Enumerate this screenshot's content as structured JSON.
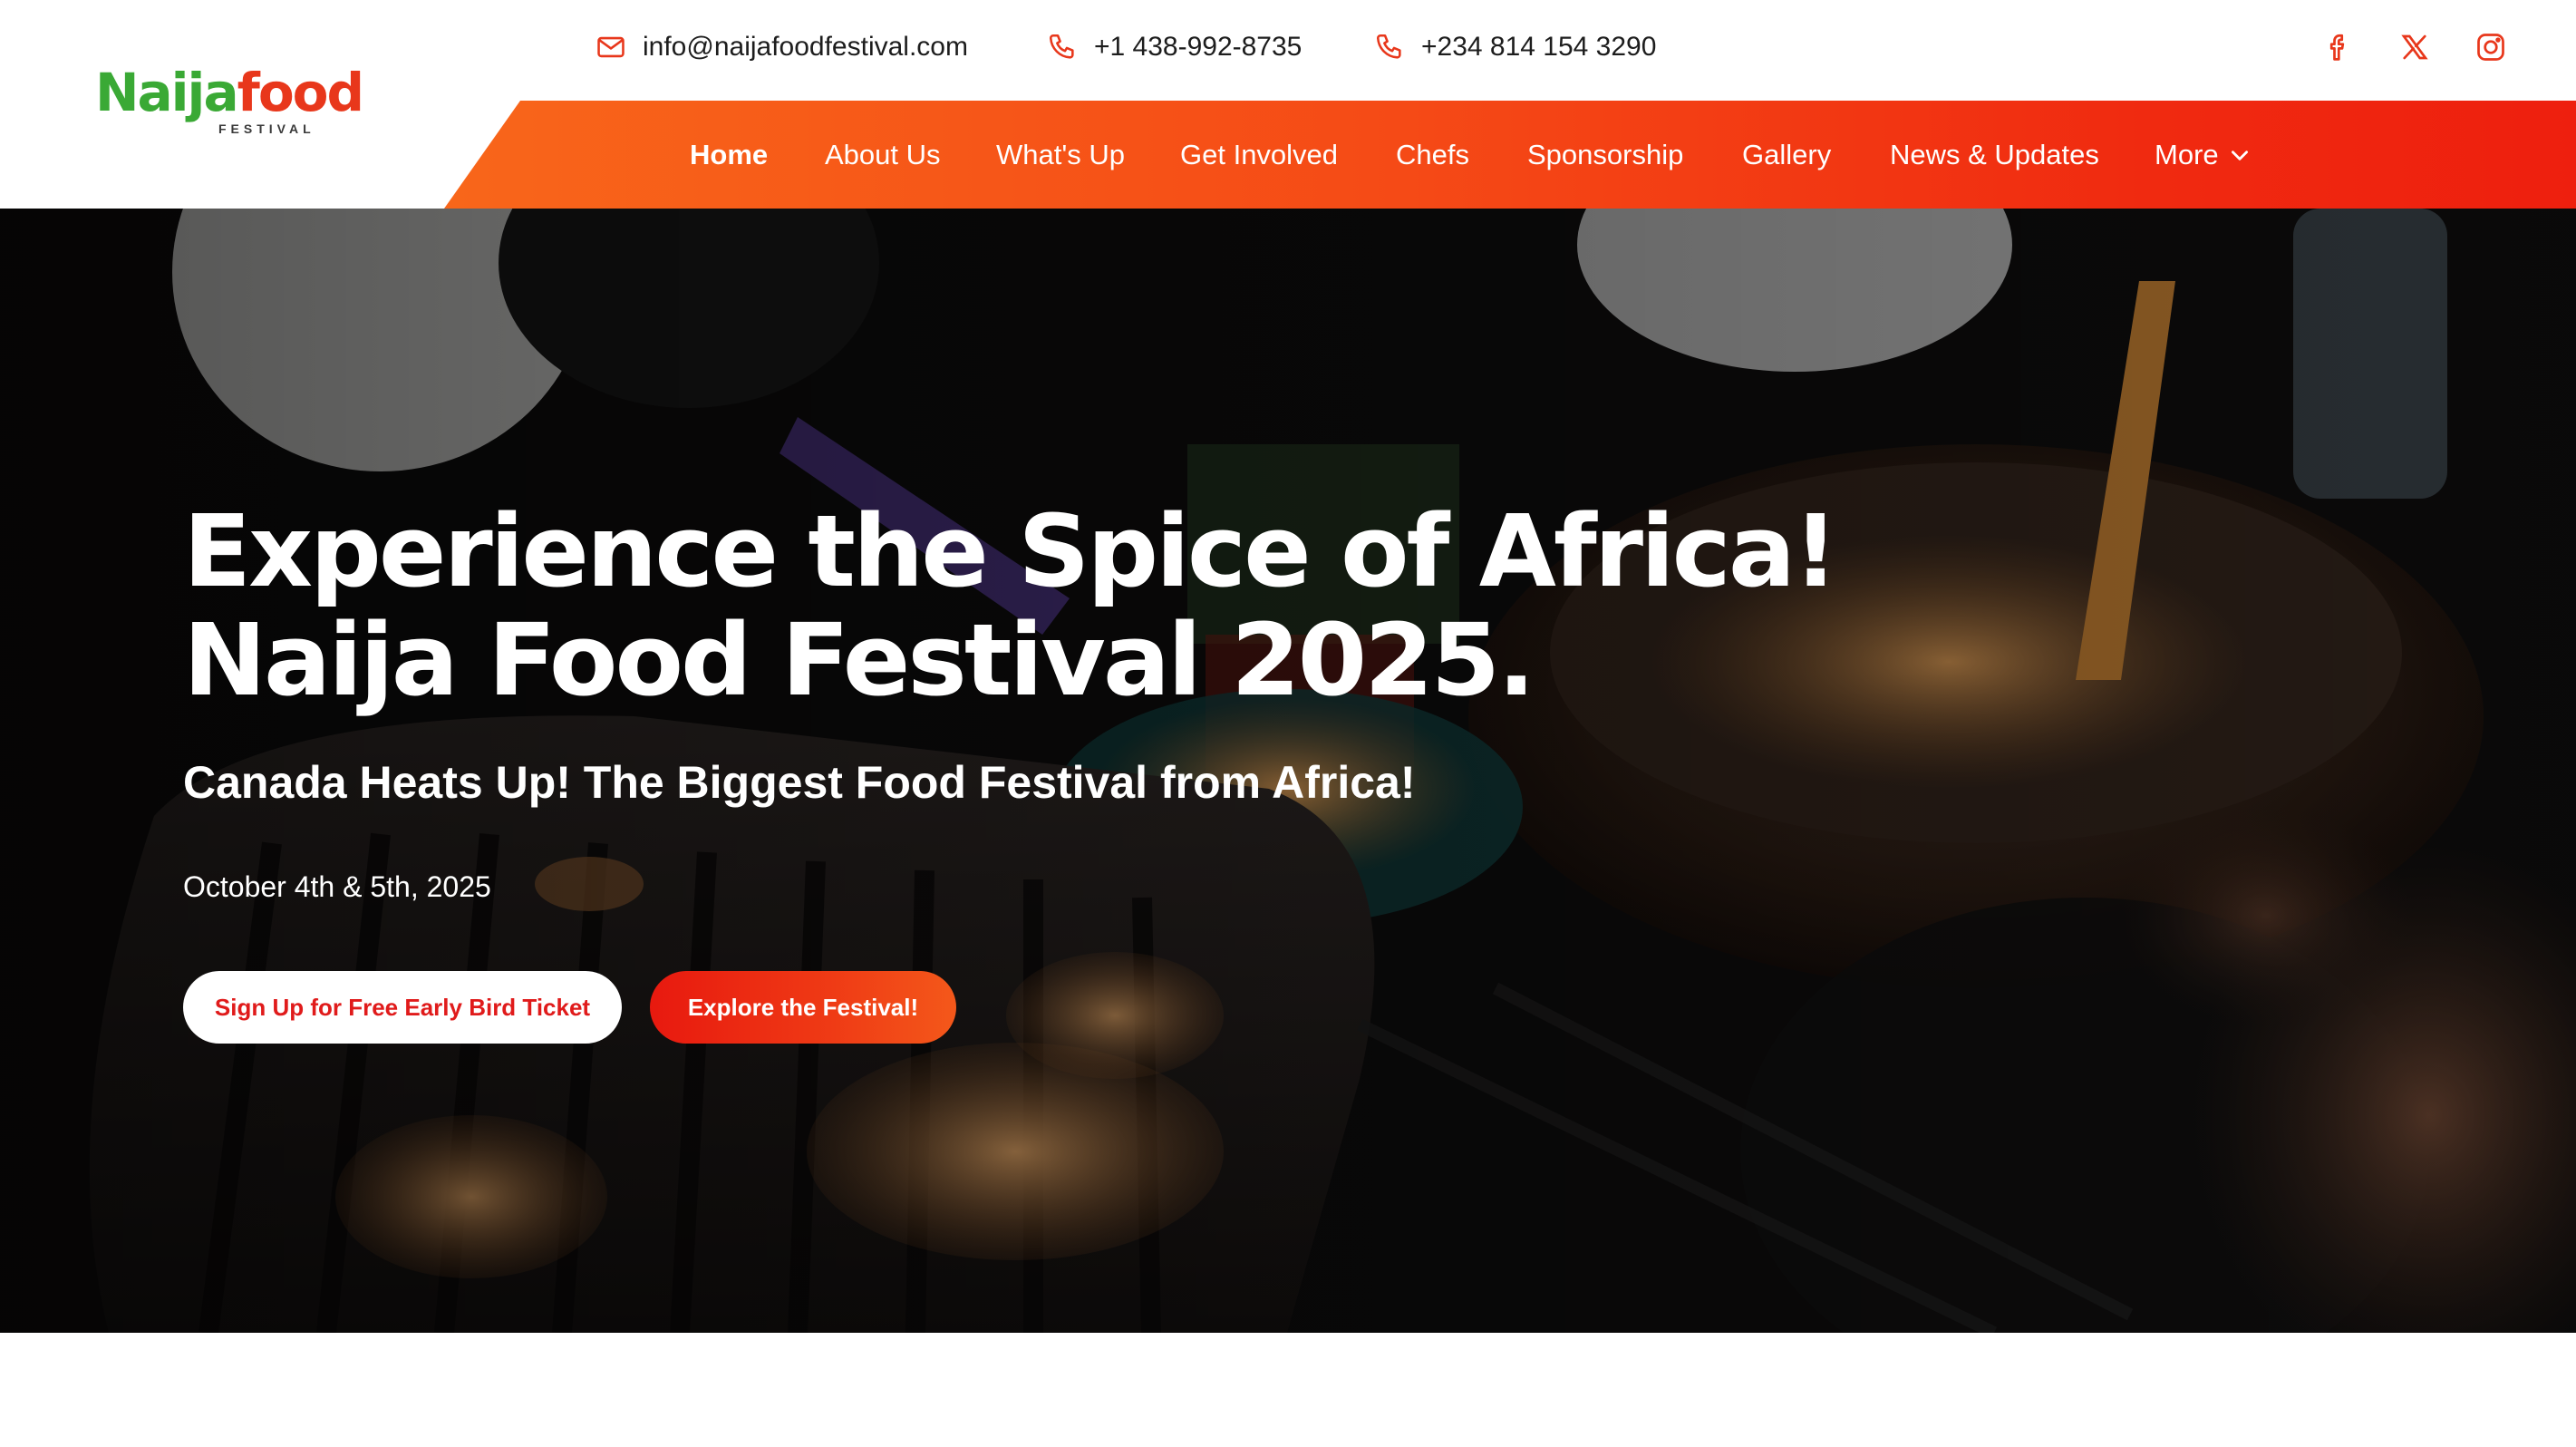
{
  "brand": {
    "logo_text_part1": "Naija",
    "logo_text_part2": "food",
    "logo_subtitle": "FESTIVAL",
    "green": "#3aa935",
    "red": "#e8371b"
  },
  "topbar": {
    "email": "info@naijafoodfestival.com",
    "email_icon": "mail-icon",
    "phone1": "+1 438-992-8735",
    "phone2": "+234 814 154 3290",
    "phone_icon": "phone-icon",
    "social": [
      "facebook-icon",
      "x-icon",
      "instagram-icon"
    ],
    "accent": "#e8371b"
  },
  "nav": {
    "items": [
      {
        "label": "Home",
        "active": true
      },
      {
        "label": "About Us"
      },
      {
        "label": "What's Up"
      },
      {
        "label": "Get Involved"
      },
      {
        "label": "Chefs"
      },
      {
        "label": "Sponsorship"
      },
      {
        "label": "Gallery"
      },
      {
        "label": "News & Updates"
      },
      {
        "label": "More",
        "icon": "chevron-down-icon"
      }
    ],
    "gradient_start": "#f8661a",
    "gradient_end": "#ee1f0e"
  },
  "hero": {
    "title_line1": "Experience the Spice of Africa!",
    "title_line2": "Naija Food Festival 2025.",
    "subtitle": "Canada Heats Up! The Biggest Food Festival from Africa!",
    "date": "October 4th & 5th, 2025",
    "primary_button": "Sign Up for Free Early Bird Ticket",
    "secondary_button": "Explore the Festival!"
  }
}
